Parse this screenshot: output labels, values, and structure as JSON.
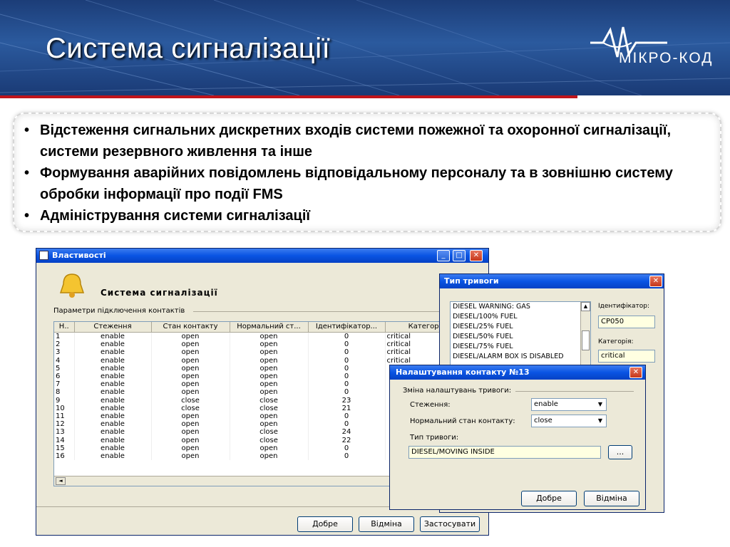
{
  "slide": {
    "title": "Система сигналізації",
    "logo_text": "МІКРО-КОД",
    "bullets": [
      "Відстеження сигнальних дискретних входів системи пожежної та охоронної сигналізації, системи резервного живлення та інше",
      "Формування аварійних повідомлень відповідальному персоналу та в зовнішню систему обробки інформації про події FMS",
      "Адміністрування системи сигналізації"
    ]
  },
  "props_window": {
    "title": "Властивості",
    "heading": "Система сигналізації",
    "group_label": "Параметри підключення контактів",
    "columns": [
      "Н..",
      "Стеження",
      "Стан контакту",
      "Нормальний ст...",
      "Ідентифікатор...",
      "Категория ав"
    ],
    "rows": [
      [
        "1",
        "enable",
        "open",
        "open",
        "0",
        "critical"
      ],
      [
        "2",
        "enable",
        "open",
        "open",
        "0",
        "critical"
      ],
      [
        "3",
        "enable",
        "open",
        "open",
        "0",
        "critical"
      ],
      [
        "4",
        "enable",
        "open",
        "open",
        "0",
        "critical"
      ],
      [
        "5",
        "enable",
        "open",
        "open",
        "0",
        ""
      ],
      [
        "6",
        "enable",
        "open",
        "open",
        "0",
        ""
      ],
      [
        "7",
        "enable",
        "open",
        "open",
        "0",
        ""
      ],
      [
        "8",
        "enable",
        "open",
        "open",
        "0",
        ""
      ],
      [
        "9",
        "enable",
        "close",
        "close",
        "23",
        ""
      ],
      [
        "10",
        "enable",
        "close",
        "close",
        "21",
        ""
      ],
      [
        "11",
        "enable",
        "open",
        "open",
        "0",
        ""
      ],
      [
        "12",
        "enable",
        "open",
        "open",
        "0",
        ""
      ],
      [
        "13",
        "enable",
        "open",
        "close",
        "24",
        ""
      ],
      [
        "14",
        "enable",
        "open",
        "close",
        "22",
        ""
      ],
      [
        "15",
        "enable",
        "open",
        "open",
        "0",
        ""
      ],
      [
        "16",
        "enable",
        "open",
        "open",
        "0",
        ""
      ]
    ],
    "ok_label": "Добре",
    "cancel_label": "Відміна",
    "apply_label": "Застосувати"
  },
  "alarm_type_window": {
    "title": "Тип тривоги",
    "items": [
      "DIESEL WARNING: GAS",
      "DIESEL/100% FUEL",
      "DIESEL/25% FUEL",
      "DIESEL/50% FUEL",
      "DIESEL/75% FUEL",
      "DIESEL/ALARM BOX IS DISABLED"
    ],
    "id_label": "Ідентифікатор:",
    "id_value": "CP050",
    "category_label": "Категорія:",
    "category_value": "critical"
  },
  "contact_window": {
    "title": "Налаштування контакту №13",
    "group_label": "Зміна налаштувань тривоги:",
    "tracking_label": "Стеження:",
    "tracking_value": "enable",
    "normal_state_label": "Нормальний стан контакту:",
    "normal_state_value": "close",
    "alarm_type_label": "Тип тривоги:",
    "alarm_type_value": "DIESEL/MOVING INSIDE",
    "browse_label": "...",
    "ok_label": "Добре",
    "cancel_label": "Відміна"
  }
}
